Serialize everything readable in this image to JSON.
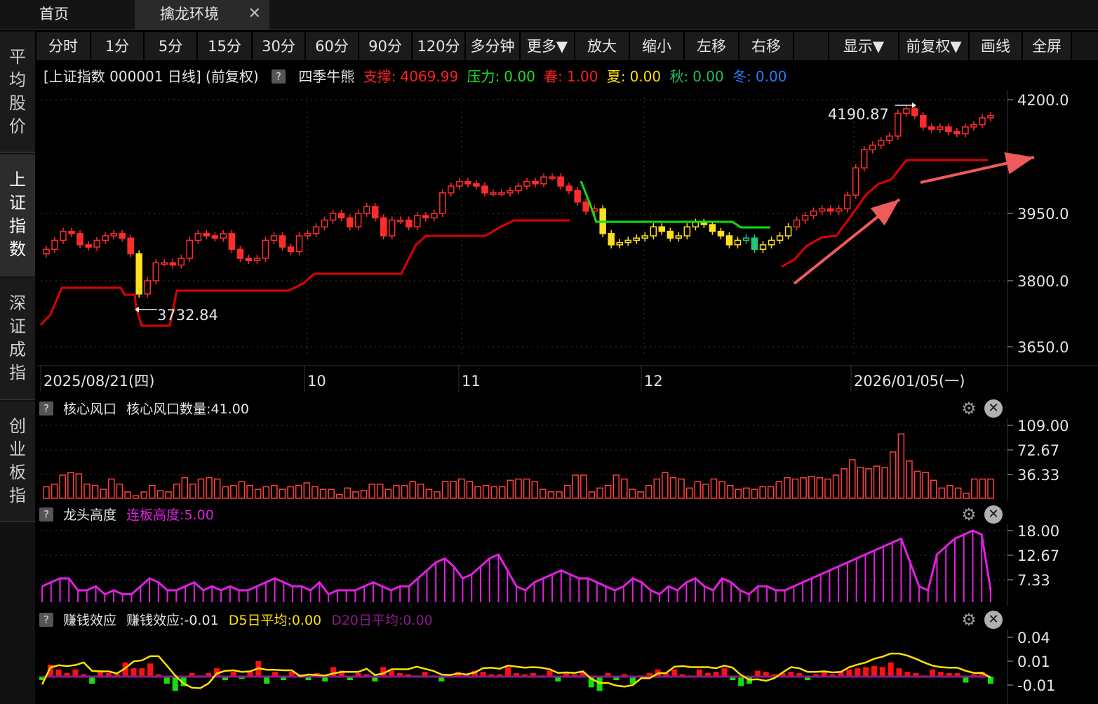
{
  "tabs": {
    "home": "首页",
    "active": "擒龙环境",
    "close": "✕"
  },
  "sidebar": [
    {
      "label": "平均股价",
      "active": false
    },
    {
      "label": "上证指数",
      "active": true
    },
    {
      "label": "深证成指",
      "active": false
    },
    {
      "label": "创业板指",
      "active": false
    }
  ],
  "toolbar": [
    "分时",
    "1分",
    "5分",
    "15分",
    "30分",
    "60分",
    "90分",
    "120分",
    "多分钟",
    "更多▼",
    "放大",
    "缩小",
    "左移",
    "右移",
    "",
    "显示▼",
    "前复权▼",
    "画线",
    "全屏"
  ],
  "main_chart": {
    "title": "[上证指数 000001 日线] (前复权)",
    "help": "?",
    "indicator_name": "四季牛熊",
    "support": {
      "label": "支撑:",
      "value": "4069.99",
      "color": "#ff2020"
    },
    "pressure": {
      "label": "压力:",
      "value": "0.00",
      "color": "#20e020"
    },
    "spring": {
      "label": "春:",
      "value": "1.00",
      "color": "#ff2020"
    },
    "summer": {
      "label": "夏:",
      "value": "0.00",
      "color": "#ffe000"
    },
    "autumn": {
      "label": "秋:",
      "value": "0.00",
      "color": "#20c060"
    },
    "winter": {
      "label": "冬:",
      "value": "0.00",
      "color": "#2080ff"
    },
    "high_annotation": "4190.87",
    "low_annotation": "3732.84",
    "y_ticks": [
      "4200.0",
      "3950.0",
      "3800.0",
      "3650.0"
    ],
    "x_labels": [
      "2025/08/21(四)",
      "10",
      "11",
      "12",
      "2026/01/05(一)"
    ]
  },
  "panels": [
    {
      "help": "?",
      "name": "核心风口",
      "value_text": "核心风口数量:41.00",
      "y_ticks": [
        "109.00",
        "72.67",
        "36.33"
      ]
    },
    {
      "help": "?",
      "name": "龙头高度",
      "value_text": "连板高度:5.00",
      "value_color": "#e020e0",
      "y_ticks": [
        "18.00",
        "12.67",
        "7.33"
      ]
    },
    {
      "help": "?",
      "name": "赚钱效应",
      "value_text": "赚钱效应:-0.01",
      "d5": "D5日平均:0.00",
      "d20": "D20日平均:0.00",
      "y_ticks": [
        "0.04",
        "0.01",
        "-0.01"
      ]
    }
  ],
  "icons": {
    "gear": "gear-icon",
    "close": "close-circle-icon",
    "arrow": "trend-arrow-icon"
  },
  "colors": {
    "up": "#ff2c2c",
    "down": "#ff2c2c",
    "yellow": "#ffe020",
    "green": "#20c878",
    "support_line": "#e00000",
    "pressure_line": "#10e010",
    "magenta": "#e020e0"
  }
}
